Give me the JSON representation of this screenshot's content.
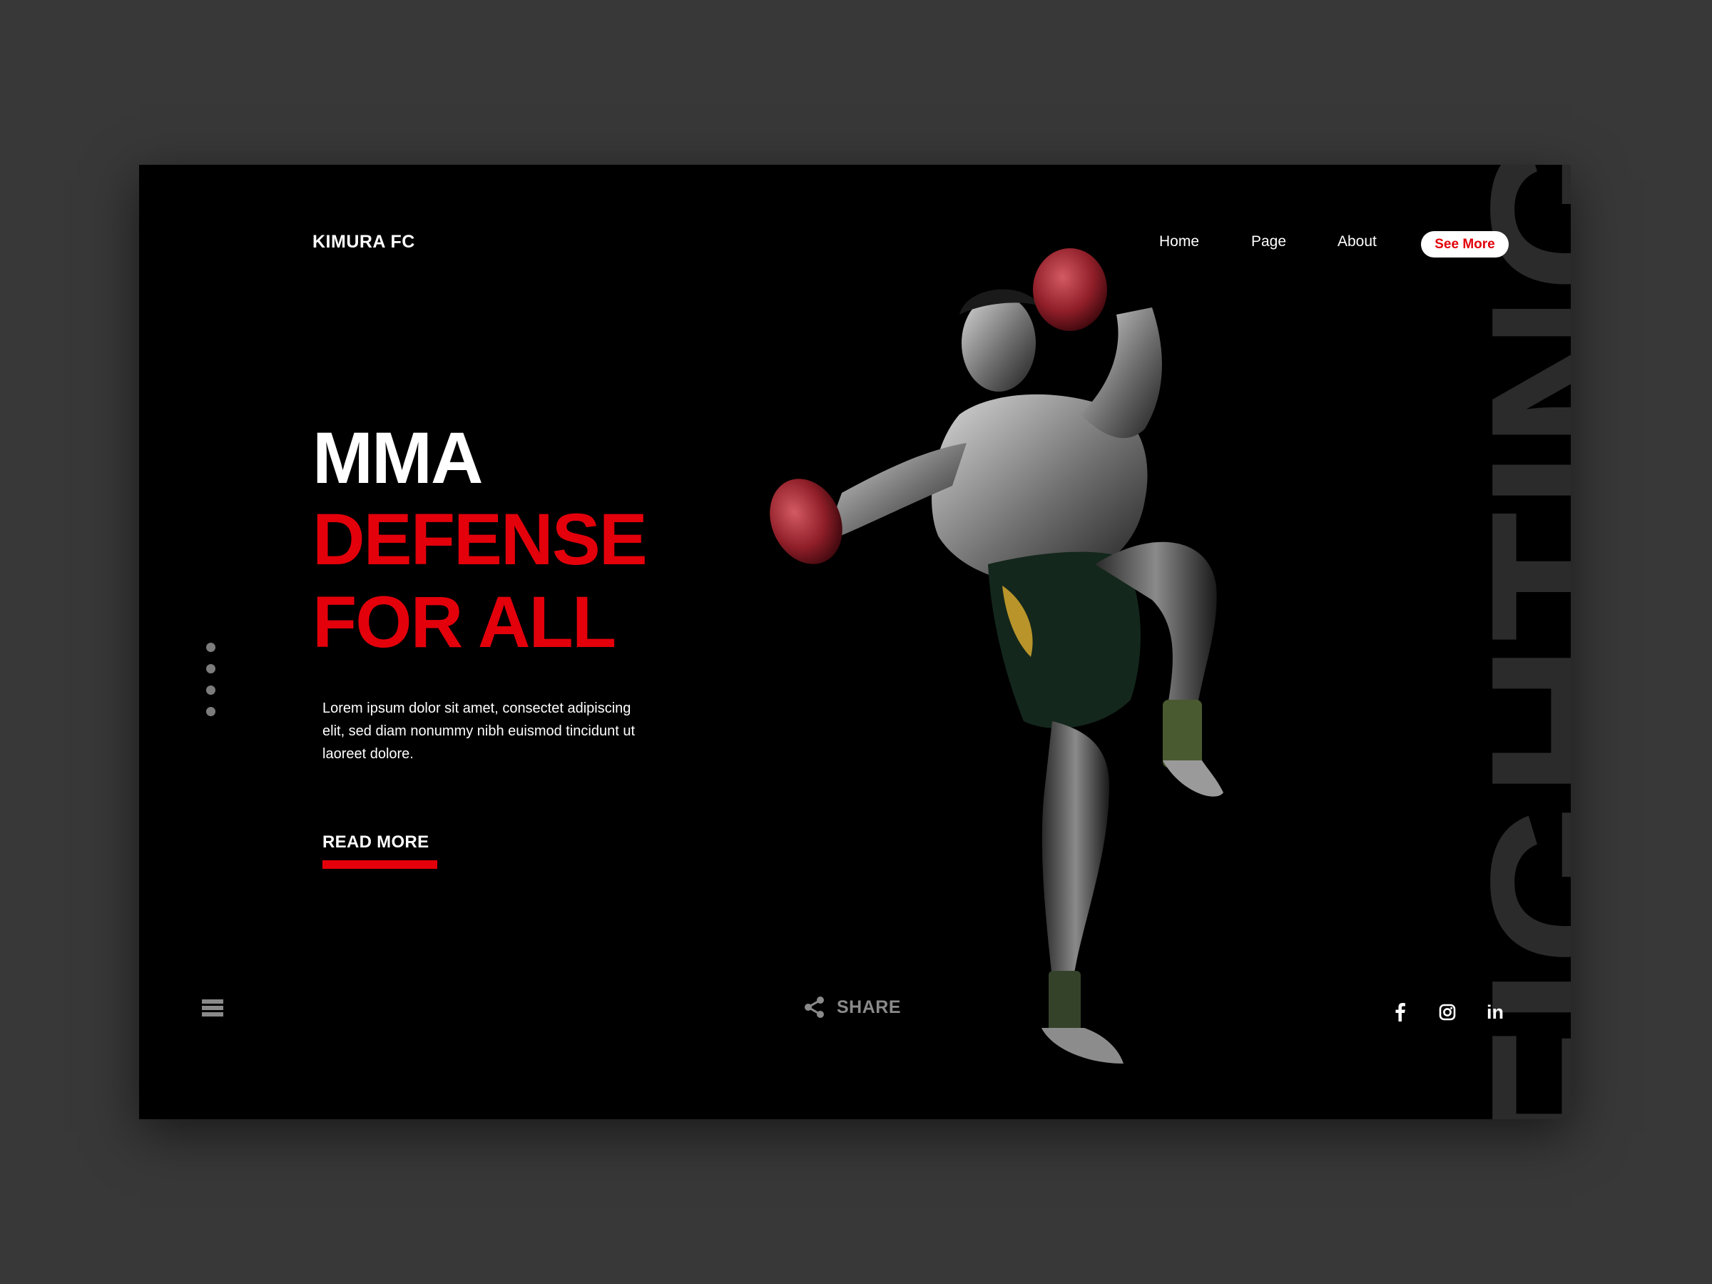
{
  "brand": {
    "name": "KIMURA FC"
  },
  "nav": {
    "items": [
      "Home",
      "Page",
      "About"
    ],
    "cta": "See More"
  },
  "hero": {
    "line1": "MMA",
    "line2": "DEFENSE",
    "line3": "FOR ALL",
    "description": "Lorem ipsum dolor sit amet, consectet adipiscing elit, sed diam nonummy nibh euismod tincidunt ut laoreet dolore.",
    "read_more": "READ MORE"
  },
  "background_word": "FIGHTING",
  "share": {
    "label": "SHARE"
  },
  "social": {
    "linkedin": "in"
  },
  "colors": {
    "background": "#000000",
    "accent": "#e3000b",
    "outer": "#383838"
  },
  "icons": [
    "menu-icon",
    "share-icon",
    "facebook-icon",
    "instagram-icon",
    "linkedin-icon"
  ]
}
